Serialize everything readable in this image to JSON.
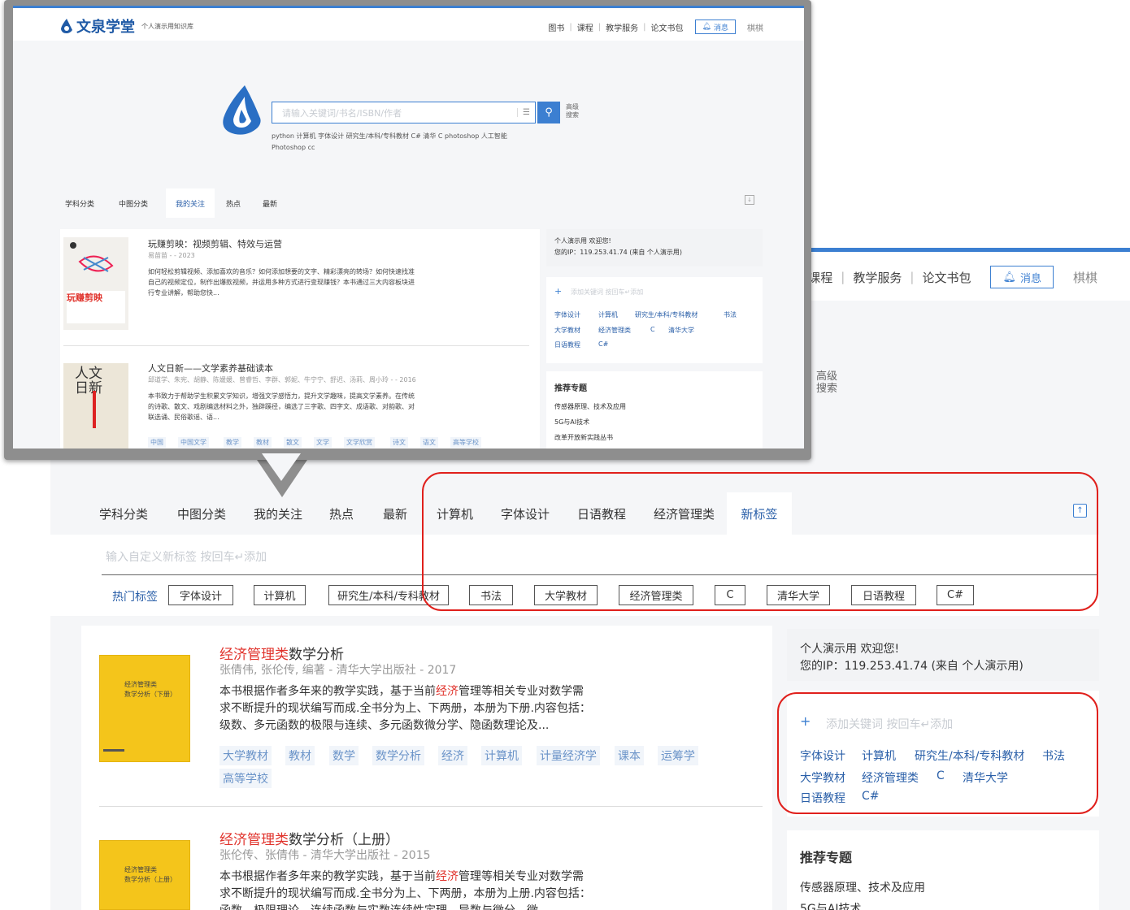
{
  "brand": {
    "name": "文泉学堂",
    "subtitle": "个人演示用知识库"
  },
  "nav": {
    "items": [
      "图书",
      "课程",
      "教学服务",
      "论文书包"
    ],
    "bg_items": [
      "课程",
      "教学服务",
      "论文书包"
    ],
    "messages": "消息",
    "user": "棋棋"
  },
  "search": {
    "placeholder": "请输入关键词/书名/ISBN/作者",
    "advanced": "高级搜索",
    "quick_line1": "python  计算机  字体设计  研究生/本科/专科教材  C#  清华  C  photoshop  人工智能",
    "quick_line2": "Photoshop cc"
  },
  "tabs": {
    "subject": "学科分类",
    "clc": "中图分类",
    "follow": "我的关注",
    "hot": "热点",
    "latest": "最新",
    "custom": [
      "计算机",
      "字体设计",
      "日语教程",
      "经济管理类"
    ],
    "new_tag": "新标签"
  },
  "tag_panel": {
    "input_placeholder": "输入自定义新标签 按回车↵添加",
    "hot_label": "热门标签",
    "chips": [
      "字体设计",
      "计算机",
      "研究生/本科/专科教材",
      "书法",
      "大学教材",
      "经济管理类",
      "C",
      "清华大学",
      "日语教程",
      "C#"
    ]
  },
  "callout_books": [
    {
      "title": "玩赚剪映：视频剪辑、特效与运营",
      "meta": "易苗苗 - - 2023",
      "desc": "如何轻松剪辑视频、添加喜欢的音乐？如何添加想要的文字、精彩漂亮的转场？如何快速找准自己的视频定位，制作出爆款视频，并运用多种方式进行变现赚钱？本书通过三大内容板块进行专业讲解，帮助您快...",
      "cover_title": "玩赚剪映"
    },
    {
      "title": "人文日新——文学素养基础读本",
      "meta": "邱道学、朱宪、胡静、陈媛媛、曾睿哲、李群、郭妮、牛宁宁、舒迟、汤莉、周小玲 - - 2016",
      "desc": "本书致力于帮助学生积累文学知识，增强文学感悟力，提升文学趣味，提高文学素养。在传统的诗歌、散文、戏剧编选材料之外，独辟蹊径，编选了三字歌、四字文、成语歌、对韵歌、对联选诵、民俗歌谣、语...",
      "cover_title": "人文日新",
      "tags": [
        "中国",
        "中国文学",
        "教学",
        "教材",
        "散文",
        "文学",
        "文学欣赏",
        "诗文",
        "语文",
        "高等学校"
      ]
    }
  ],
  "books": [
    {
      "title_highlight": "经济管理类",
      "title_rest": "数学分析",
      "meta": "张倩伟, 张伦传, 编著 - 清华大学出版社 - 2017",
      "desc_pre": "本书根据作者多年来的教学实践，基于当前",
      "desc_highlight": "经济",
      "desc_post": "管理等相关专业对数学需求不断提升的现状编写而成.全书分为上、下两册，本册为下册.内容包括：级数、多元函数的极限与连续、多元函数微分学、隐函数理论及...",
      "tags": [
        "大学教材",
        "教材",
        "数学",
        "数学分析",
        "经济",
        "计算机",
        "计量经济学",
        "课本",
        "运筹学",
        "高等学校"
      ],
      "cover_l1": "经济管理类",
      "cover_l2": "数学分析（下册）"
    },
    {
      "title_highlight": "经济管理类",
      "title_rest": "数学分析（上册）",
      "meta": "张伦传、张倩伟 - 清华大学出版社 - 2015",
      "desc_pre": "本书根据作者多年来的教学实践，基于当前",
      "desc_highlight": "经济",
      "desc_post": "管理等相关专业对数学需求不断提升的现状编写而成.全书分为上、下两册，本册为上册.内容包括：函数、极限理论、连续函数与实数连续性定理、导数与微分、微...",
      "cover_l1": "经济管理类",
      "cover_l2": "数学分析（上册）"
    }
  ],
  "sidebar": {
    "welcome_user": "个人演示用",
    "welcome_text": "欢迎您!",
    "ip_label": "您的IP：",
    "ip": "119.253.41.74",
    "ip_note": "(来自 个人演示用)",
    "add_keyword": "添加关键词 按回车↵添加",
    "keywords": [
      "字体设计",
      "计算机",
      "研究生/本科/专科教材",
      "书法",
      "大学教材",
      "经济管理类",
      "C",
      "清华大学",
      "日语教程",
      "C#"
    ],
    "topics_title": "推荐专题",
    "topics": [
      "传感器原理、技术及应用",
      "5G与AI技术",
      "改革开放新实践丛书"
    ]
  },
  "colors": {
    "accent": "#3c7fd1",
    "link": "#2a5fa8",
    "highlight": "#e0322b",
    "annotation": "#e0201c"
  }
}
